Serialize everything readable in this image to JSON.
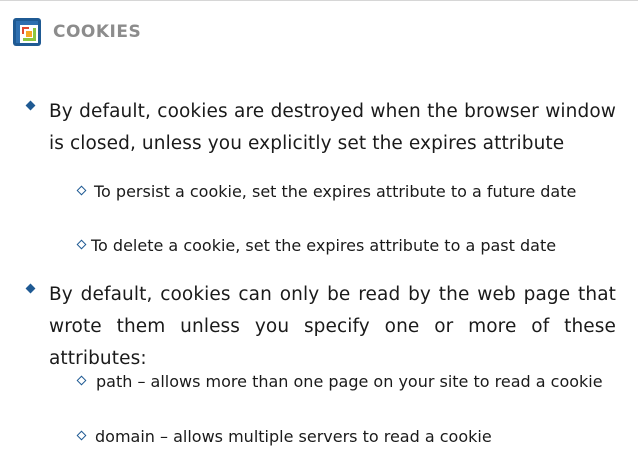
{
  "slide": {
    "title": "COOKIES",
    "logo_icon": "presentation-app-logo-icon",
    "accent_color": "#1f5a93"
  },
  "bullets": [
    {
      "text": "By default, cookies are destroyed when the browser window is closed, unless you explicitly set the expires attribute",
      "sub": [
        "To persist a cookie, set the expires attribute to a future date",
        "To delete a cookie, set the expires attribute to a past date"
      ]
    },
    {
      "text": "By default, cookies can only be read by the web page that wrote them unless you specify one or more of these attributes:",
      "sub": [
        "path – allows more than one page on your site to read a cookie",
        "domain – allows multiple servers to read a cookie"
      ]
    }
  ]
}
